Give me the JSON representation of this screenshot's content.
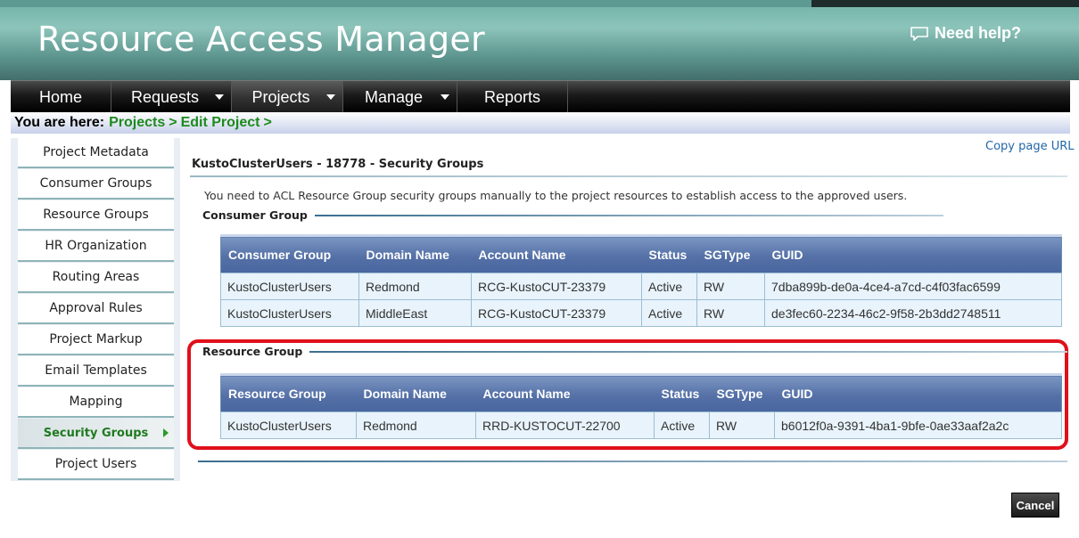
{
  "header": {
    "app_title": "Resource Access Manager",
    "help_label": "Need help?"
  },
  "nav": {
    "items": [
      {
        "label": "Home",
        "has_dropdown": false
      },
      {
        "label": "Requests",
        "has_dropdown": true
      },
      {
        "label": "Projects",
        "has_dropdown": true,
        "active": true
      },
      {
        "label": "Manage",
        "has_dropdown": true
      },
      {
        "label": "Reports",
        "has_dropdown": false
      }
    ]
  },
  "breadcrumb": {
    "prefix": "You are here:",
    "items": [
      "Projects",
      "Edit Project"
    ],
    "separator": ">"
  },
  "sidebar": {
    "items": [
      {
        "label": "Project Metadata"
      },
      {
        "label": "Consumer Groups"
      },
      {
        "label": "Resource Groups"
      },
      {
        "label": "HR Organization"
      },
      {
        "label": "Routing Areas"
      },
      {
        "label": "Approval Rules"
      },
      {
        "label": "Project Markup"
      },
      {
        "label": "Email Templates"
      },
      {
        "label": "Mapping"
      },
      {
        "label": "Security Groups",
        "active": true
      },
      {
        "label": "Project Users"
      }
    ]
  },
  "main": {
    "copy_url_label": "Copy page URL",
    "heading": "KustoClusterUsers - 18778 - Security Groups",
    "instruction": "You need to ACL Resource Group security groups manually to the project resources to establish access to the approved users.",
    "consumer_section": {
      "label": "Consumer Group",
      "columns": [
        "Consumer Group",
        "Domain Name",
        "Account Name",
        "Status",
        "SGType",
        "GUID"
      ],
      "rows": [
        [
          "KustoClusterUsers",
          "Redmond",
          "RCG-KustoCUT-23379",
          "Active",
          "RW",
          "7dba899b-de0a-4ce4-a7cd-c4f03fac6599"
        ],
        [
          "KustoClusterUsers",
          "MiddleEast",
          "RCG-KustoCUT-23379",
          "Active",
          "RW",
          "de3fec60-2234-46c2-9f58-2b3dd2748511"
        ]
      ]
    },
    "resource_section": {
      "label": "Resource Group",
      "columns": [
        "Resource Group",
        "Domain Name",
        "Account Name",
        "Status",
        "SGType",
        "GUID"
      ],
      "rows": [
        [
          "KustoClusterUsers",
          "Redmond",
          "RRD-KUSTOCUT-22700",
          "Active",
          "RW",
          "b6012f0a-9391-4ba1-9bfe-0ae33aaf2a2c"
        ]
      ]
    },
    "cancel_label": "Cancel"
  },
  "colors": {
    "breadcrumb_link": "#1e8a1e",
    "highlight": "#e0101a",
    "table_header": "#5470a6"
  }
}
